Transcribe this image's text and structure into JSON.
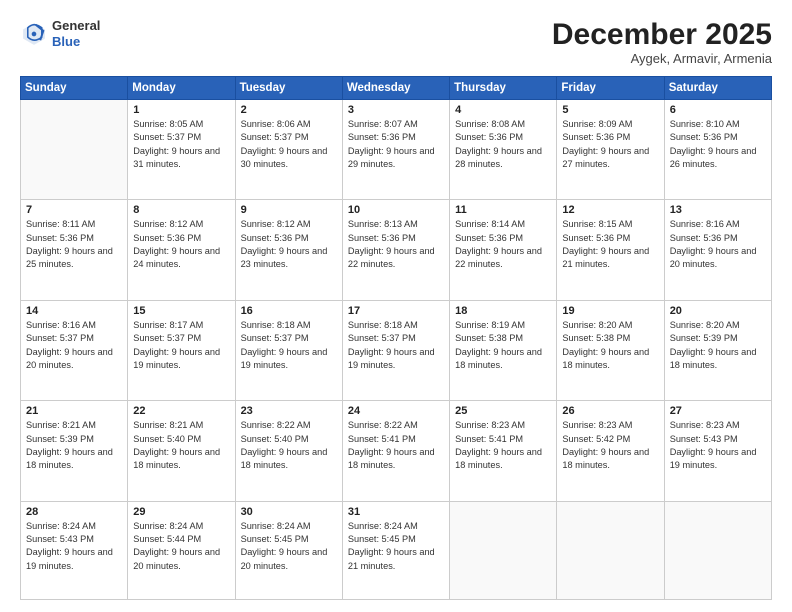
{
  "logo": {
    "general": "General",
    "blue": "Blue"
  },
  "header": {
    "month": "December 2025",
    "location": "Aygek, Armavir, Armenia"
  },
  "days_of_week": [
    "Sunday",
    "Monday",
    "Tuesday",
    "Wednesday",
    "Thursday",
    "Friday",
    "Saturday"
  ],
  "weeks": [
    [
      {
        "day": "",
        "sunrise": "",
        "sunset": "",
        "daylight": ""
      },
      {
        "day": "1",
        "sunrise": "Sunrise: 8:05 AM",
        "sunset": "Sunset: 5:37 PM",
        "daylight": "Daylight: 9 hours and 31 minutes."
      },
      {
        "day": "2",
        "sunrise": "Sunrise: 8:06 AM",
        "sunset": "Sunset: 5:37 PM",
        "daylight": "Daylight: 9 hours and 30 minutes."
      },
      {
        "day": "3",
        "sunrise": "Sunrise: 8:07 AM",
        "sunset": "Sunset: 5:36 PM",
        "daylight": "Daylight: 9 hours and 29 minutes."
      },
      {
        "day": "4",
        "sunrise": "Sunrise: 8:08 AM",
        "sunset": "Sunset: 5:36 PM",
        "daylight": "Daylight: 9 hours and 28 minutes."
      },
      {
        "day": "5",
        "sunrise": "Sunrise: 8:09 AM",
        "sunset": "Sunset: 5:36 PM",
        "daylight": "Daylight: 9 hours and 27 minutes."
      },
      {
        "day": "6",
        "sunrise": "Sunrise: 8:10 AM",
        "sunset": "Sunset: 5:36 PM",
        "daylight": "Daylight: 9 hours and 26 minutes."
      }
    ],
    [
      {
        "day": "7",
        "sunrise": "Sunrise: 8:11 AM",
        "sunset": "Sunset: 5:36 PM",
        "daylight": "Daylight: 9 hours and 25 minutes."
      },
      {
        "day": "8",
        "sunrise": "Sunrise: 8:12 AM",
        "sunset": "Sunset: 5:36 PM",
        "daylight": "Daylight: 9 hours and 24 minutes."
      },
      {
        "day": "9",
        "sunrise": "Sunrise: 8:12 AM",
        "sunset": "Sunset: 5:36 PM",
        "daylight": "Daylight: 9 hours and 23 minutes."
      },
      {
        "day": "10",
        "sunrise": "Sunrise: 8:13 AM",
        "sunset": "Sunset: 5:36 PM",
        "daylight": "Daylight: 9 hours and 22 minutes."
      },
      {
        "day": "11",
        "sunrise": "Sunrise: 8:14 AM",
        "sunset": "Sunset: 5:36 PM",
        "daylight": "Daylight: 9 hours and 22 minutes."
      },
      {
        "day": "12",
        "sunrise": "Sunrise: 8:15 AM",
        "sunset": "Sunset: 5:36 PM",
        "daylight": "Daylight: 9 hours and 21 minutes."
      },
      {
        "day": "13",
        "sunrise": "Sunrise: 8:16 AM",
        "sunset": "Sunset: 5:36 PM",
        "daylight": "Daylight: 9 hours and 20 minutes."
      }
    ],
    [
      {
        "day": "14",
        "sunrise": "Sunrise: 8:16 AM",
        "sunset": "Sunset: 5:37 PM",
        "daylight": "Daylight: 9 hours and 20 minutes."
      },
      {
        "day": "15",
        "sunrise": "Sunrise: 8:17 AM",
        "sunset": "Sunset: 5:37 PM",
        "daylight": "Daylight: 9 hours and 19 minutes."
      },
      {
        "day": "16",
        "sunrise": "Sunrise: 8:18 AM",
        "sunset": "Sunset: 5:37 PM",
        "daylight": "Daylight: 9 hours and 19 minutes."
      },
      {
        "day": "17",
        "sunrise": "Sunrise: 8:18 AM",
        "sunset": "Sunset: 5:37 PM",
        "daylight": "Daylight: 9 hours and 19 minutes."
      },
      {
        "day": "18",
        "sunrise": "Sunrise: 8:19 AM",
        "sunset": "Sunset: 5:38 PM",
        "daylight": "Daylight: 9 hours and 18 minutes."
      },
      {
        "day": "19",
        "sunrise": "Sunrise: 8:20 AM",
        "sunset": "Sunset: 5:38 PM",
        "daylight": "Daylight: 9 hours and 18 minutes."
      },
      {
        "day": "20",
        "sunrise": "Sunrise: 8:20 AM",
        "sunset": "Sunset: 5:39 PM",
        "daylight": "Daylight: 9 hours and 18 minutes."
      }
    ],
    [
      {
        "day": "21",
        "sunrise": "Sunrise: 8:21 AM",
        "sunset": "Sunset: 5:39 PM",
        "daylight": "Daylight: 9 hours and 18 minutes."
      },
      {
        "day": "22",
        "sunrise": "Sunrise: 8:21 AM",
        "sunset": "Sunset: 5:40 PM",
        "daylight": "Daylight: 9 hours and 18 minutes."
      },
      {
        "day": "23",
        "sunrise": "Sunrise: 8:22 AM",
        "sunset": "Sunset: 5:40 PM",
        "daylight": "Daylight: 9 hours and 18 minutes."
      },
      {
        "day": "24",
        "sunrise": "Sunrise: 8:22 AM",
        "sunset": "Sunset: 5:41 PM",
        "daylight": "Daylight: 9 hours and 18 minutes."
      },
      {
        "day": "25",
        "sunrise": "Sunrise: 8:23 AM",
        "sunset": "Sunset: 5:41 PM",
        "daylight": "Daylight: 9 hours and 18 minutes."
      },
      {
        "day": "26",
        "sunrise": "Sunrise: 8:23 AM",
        "sunset": "Sunset: 5:42 PM",
        "daylight": "Daylight: 9 hours and 18 minutes."
      },
      {
        "day": "27",
        "sunrise": "Sunrise: 8:23 AM",
        "sunset": "Sunset: 5:43 PM",
        "daylight": "Daylight: 9 hours and 19 minutes."
      }
    ],
    [
      {
        "day": "28",
        "sunrise": "Sunrise: 8:24 AM",
        "sunset": "Sunset: 5:43 PM",
        "daylight": "Daylight: 9 hours and 19 minutes."
      },
      {
        "day": "29",
        "sunrise": "Sunrise: 8:24 AM",
        "sunset": "Sunset: 5:44 PM",
        "daylight": "Daylight: 9 hours and 20 minutes."
      },
      {
        "day": "30",
        "sunrise": "Sunrise: 8:24 AM",
        "sunset": "Sunset: 5:45 PM",
        "daylight": "Daylight: 9 hours and 20 minutes."
      },
      {
        "day": "31",
        "sunrise": "Sunrise: 8:24 AM",
        "sunset": "Sunset: 5:45 PM",
        "daylight": "Daylight: 9 hours and 21 minutes."
      },
      {
        "day": "",
        "sunrise": "",
        "sunset": "",
        "daylight": ""
      },
      {
        "day": "",
        "sunrise": "",
        "sunset": "",
        "daylight": ""
      },
      {
        "day": "",
        "sunrise": "",
        "sunset": "",
        "daylight": ""
      }
    ]
  ]
}
